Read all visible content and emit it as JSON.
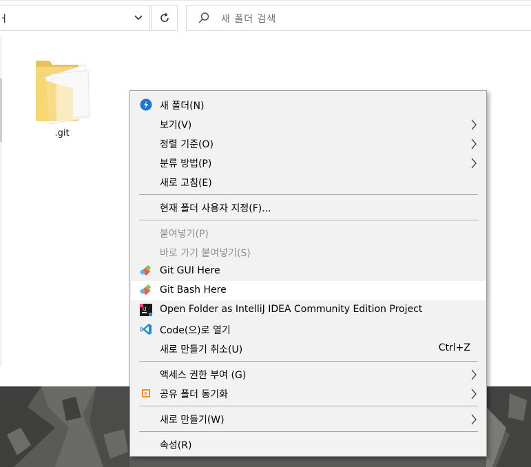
{
  "toolbar": {
    "address_partial": "ㅓ",
    "search_placeholder": "새 폴더 검색"
  },
  "content": {
    "folder_name": ".git"
  },
  "colors": {
    "menu_bg": "#f2f2f2",
    "highlight": "#ffffff",
    "disabled_text": "#8d8d8d",
    "separator": "#a8a8a8"
  },
  "menu": {
    "items": [
      {
        "label": "새 폴더(N)",
        "icon": "new-folder-shortcut-icon"
      },
      {
        "label": "보기(V)",
        "submenu": true
      },
      {
        "label": "정렬 기준(O)",
        "submenu": true
      },
      {
        "label": "분류 방법(P)",
        "submenu": true
      },
      {
        "label": "새로 고침(E)"
      },
      {
        "label": "현재 폴더 사용자 지정(F)..."
      },
      {
        "label": "붙여넣기(P)",
        "disabled": true
      },
      {
        "label": "바로 가기 붙여넣기(S)",
        "disabled": true
      },
      {
        "label": "Git GUI Here",
        "icon": "git-icon"
      },
      {
        "label": "Git Bash Here",
        "icon": "git-icon",
        "highlighted": true
      },
      {
        "label": "Open Folder as IntelliJ IDEA Community Edition Project",
        "icon": "intellij-icon"
      },
      {
        "label": "Code(으)로 열기",
        "icon": "vscode-icon"
      },
      {
        "label": "새로 만들기 취소(U)",
        "shortcut": "Ctrl+Z"
      },
      {
        "label": "액세스 권한 부여 (G)",
        "submenu": true
      },
      {
        "label": "공유 폴더 동기화",
        "icon": "sync-share-icon",
        "submenu": true
      },
      {
        "label": "새로 만들기(W)",
        "submenu": true
      },
      {
        "label": "속성(R)"
      }
    ]
  }
}
